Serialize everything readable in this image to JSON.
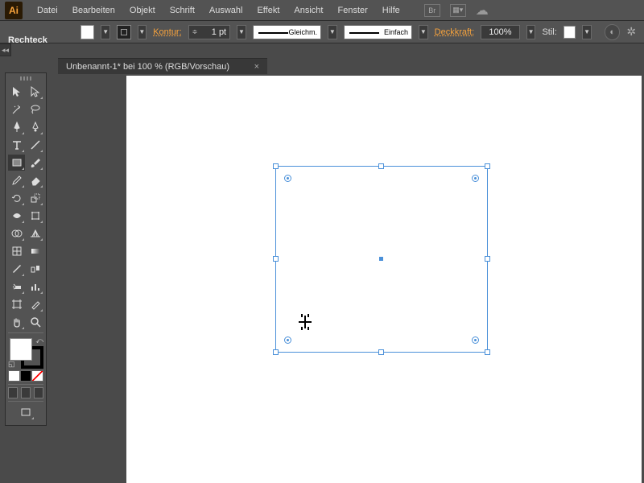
{
  "app": {
    "logo_text": "Ai"
  },
  "menu": {
    "items": [
      "Datei",
      "Bearbeiten",
      "Objekt",
      "Schrift",
      "Auswahl",
      "Effekt",
      "Ansicht",
      "Fenster",
      "Hilfe"
    ],
    "bridge_label": "Br"
  },
  "selection_type": "Rechteck",
  "control": {
    "stroke_label": "Kontur:",
    "stroke_weight": "1 pt",
    "stroke_type": "Gleichm.",
    "brush_type": "Einfach",
    "opacity_label": "Deckkraft:",
    "opacity_value": "100%",
    "style_label": "Stil:"
  },
  "document": {
    "tab_title": "Unbenannt-1* bei 100 % (RGB/Vorschau)"
  },
  "tools": {
    "list": [
      [
        "selection",
        "direct-selection"
      ],
      [
        "magic-wand",
        "lasso"
      ],
      [
        "pen",
        "curvature"
      ],
      [
        "type",
        "line-segment"
      ],
      [
        "rectangle",
        "paintbrush"
      ],
      [
        "pencil",
        "eraser"
      ],
      [
        "rotate",
        "scale"
      ],
      [
        "width",
        "free-transform"
      ],
      [
        "shape-builder",
        "perspective-grid"
      ],
      [
        "mesh",
        "gradient"
      ],
      [
        "eyedropper",
        "blend"
      ],
      [
        "symbol-sprayer",
        "column-graph"
      ],
      [
        "artboard",
        "slice"
      ],
      [
        "hand",
        "zoom"
      ]
    ],
    "active": "rectangle"
  },
  "colors": {
    "fill": "#ffffff",
    "stroke": "#000000"
  }
}
